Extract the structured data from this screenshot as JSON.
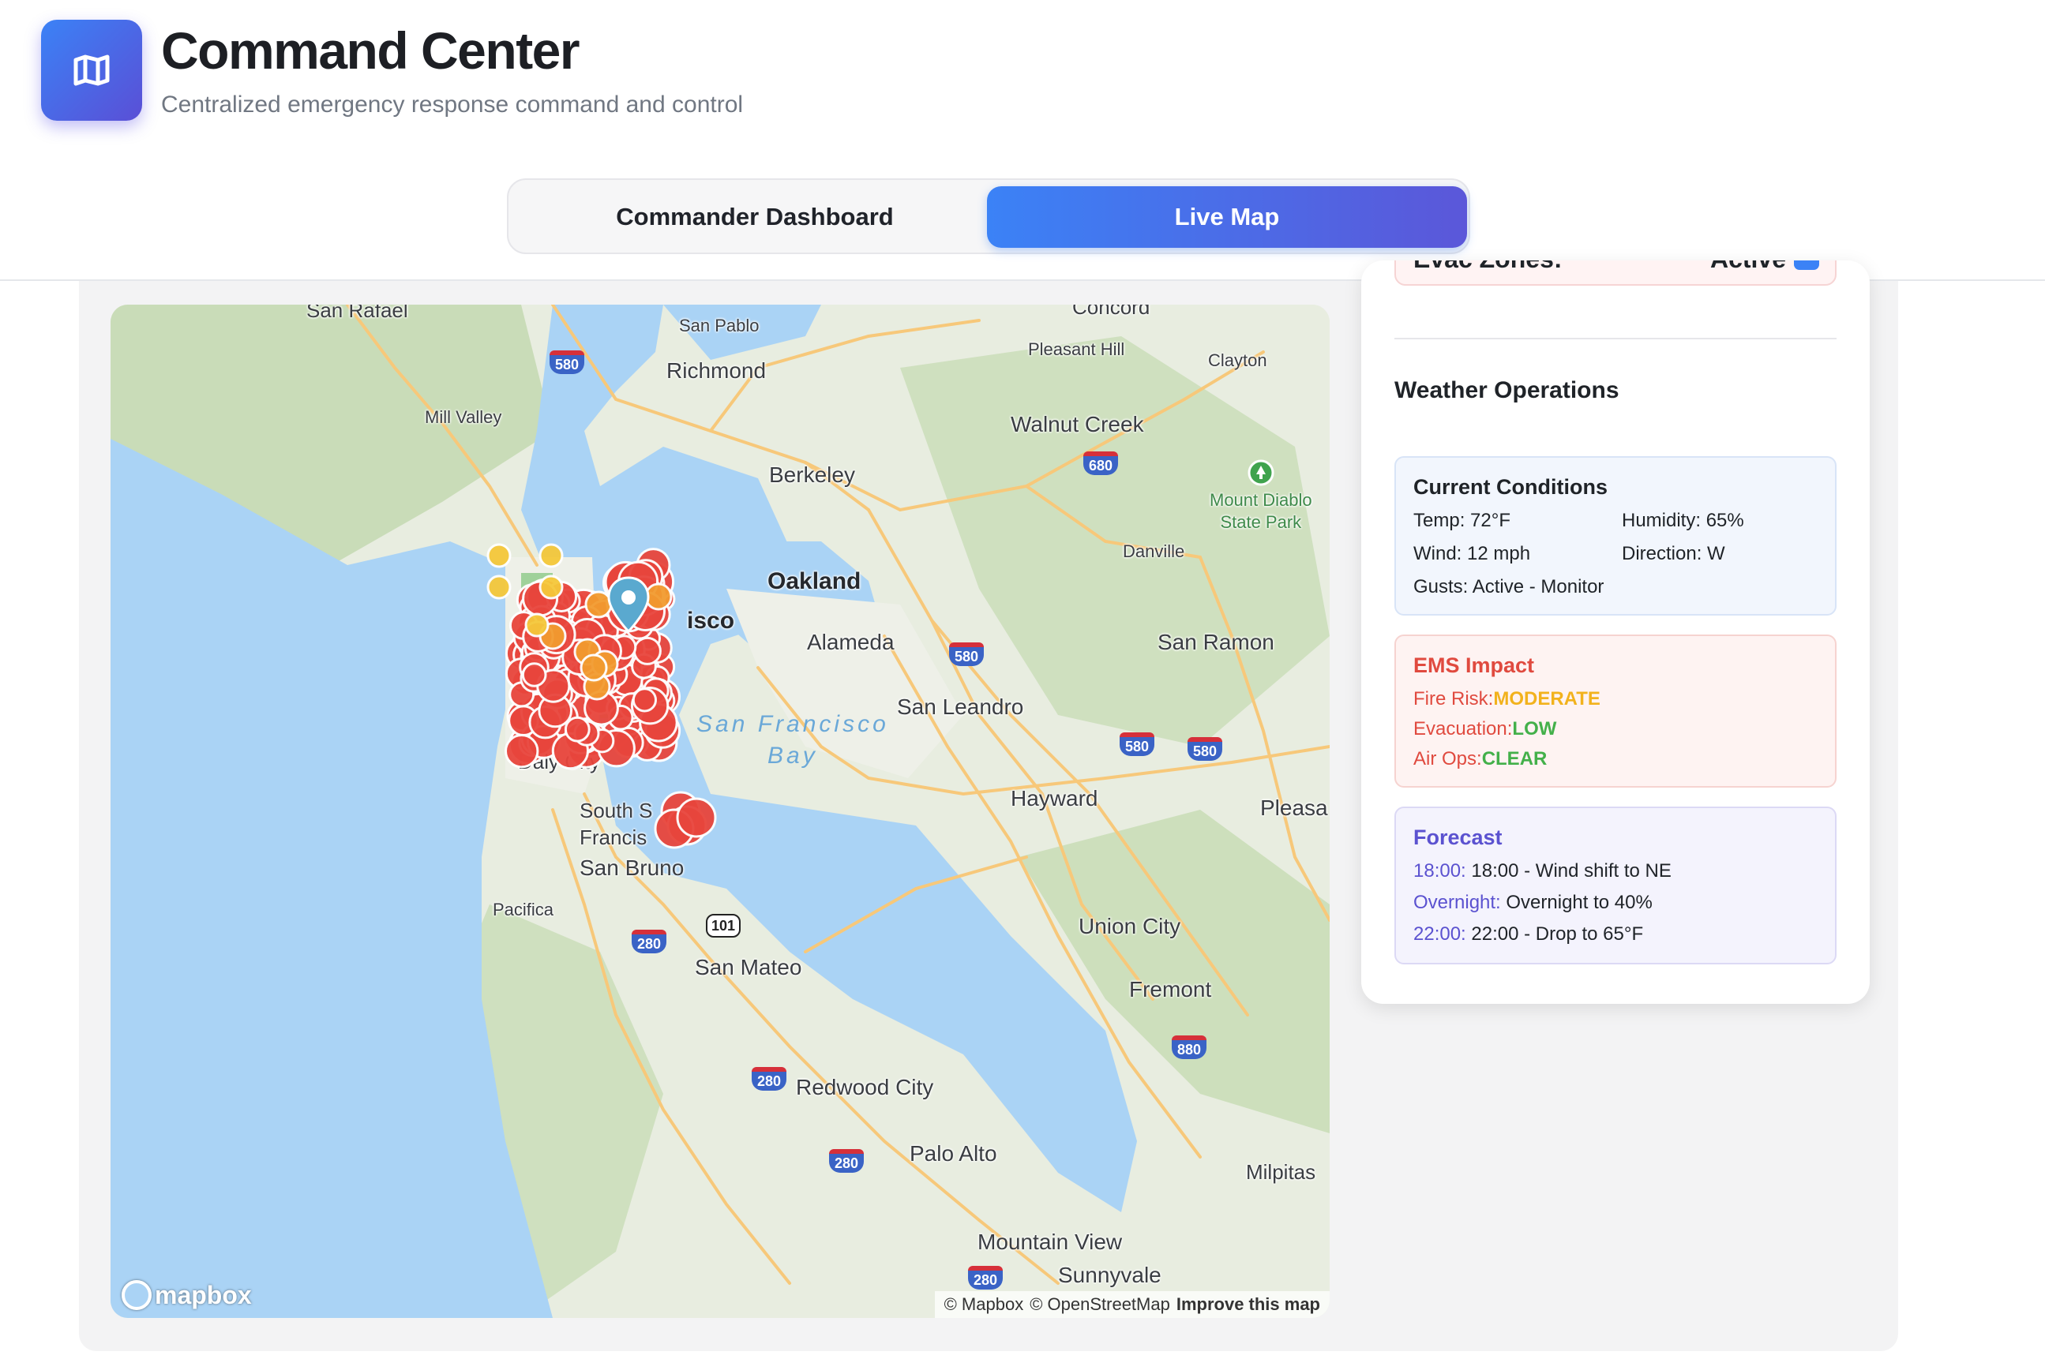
{
  "header": {
    "title": "Command Center",
    "subtitle": "Centralized emergency response command and control",
    "logo_icon": "map-icon"
  },
  "tabs": [
    {
      "label": "Commander Dashboard",
      "active": false
    },
    {
      "label": "Live Map",
      "active": true
    }
  ],
  "map": {
    "places": {
      "san_rafael": "San Rafael",
      "san_pablo": "San Pablo",
      "concord": "Concord",
      "pleasant_hill": "Pleasant Hill",
      "clayton": "Clayton",
      "richmond": "Richmond",
      "mill_valley": "Mill Valley",
      "walnut_creek": "Walnut Creek",
      "berkeley": "Berkeley",
      "mount_diablo": "Mount Diablo\nState Park",
      "danville": "Danville",
      "oakland": "Oakland",
      "sf_partial": "isco",
      "alameda": "Alameda",
      "san_ramon": "San Ramon",
      "san_leandro": "San Leandro",
      "sf_bay": "San Francisco\nBay",
      "daly_city": "Daly City",
      "south_sf": "South S\nFrancis",
      "hayward": "Hayward",
      "pleasa": "Pleasa",
      "san_bruno": "San Bruno",
      "pacifica": "Pacifica",
      "union_city": "Union City",
      "san_mateo": "San Mateo",
      "fremont": "Fremont",
      "redwood_city": "Redwood City",
      "palo_alto": "Palo Alto",
      "milpitas": "Milpitas",
      "mountain_view": "Mountain View",
      "sunnyvale": "Sunnyvale"
    },
    "shields": {
      "s580a": "580",
      "s680": "680",
      "s580b": "580",
      "s580c": "580",
      "s580d": "580",
      "s101": "101",
      "s280a": "280",
      "s280b": "280",
      "s280c": "280",
      "s880": "880",
      "s280d": "280"
    },
    "logo_text": "mapbox",
    "attribution": [
      "© Mapbox",
      "© OpenStreetMap",
      "Improve this map"
    ],
    "colors": {
      "critical": "#e8453c",
      "warning": "#f29b2f",
      "caution": "#f5c83a",
      "water": "#aad3f5",
      "pin": "#5aa9cf"
    }
  },
  "side": {
    "evac": {
      "label": "Evac Zones:",
      "value": "Active",
      "checked": true
    },
    "weather_title": "Weather Operations",
    "conditions": {
      "title": "Current Conditions",
      "temp_label": "Temp:",
      "temp": "72°F",
      "humidity_label": "Humidity:",
      "humidity": "65%",
      "wind_label": "Wind:",
      "wind": "12 mph",
      "direction_label": "Direction:",
      "direction": "W",
      "gusts_label": "Gusts:",
      "gusts": "Active - Monitor"
    },
    "ems": {
      "title": "EMS Impact",
      "fire_label": "Fire Risk:",
      "fire": "MODERATE",
      "evac_label": "Evacuation:",
      "evac": "LOW",
      "air_label": "Air Ops:",
      "air": "CLEAR"
    },
    "forecast": {
      "title": "Forecast",
      "items": [
        {
          "time": "18:00:",
          "text": "18:00 - Wind shift to NE"
        },
        {
          "time": "Overnight:",
          "text": "Overnight to 40%"
        },
        {
          "time": "22:00:",
          "text": "22:00 - Drop to 65°F"
        }
      ]
    }
  }
}
